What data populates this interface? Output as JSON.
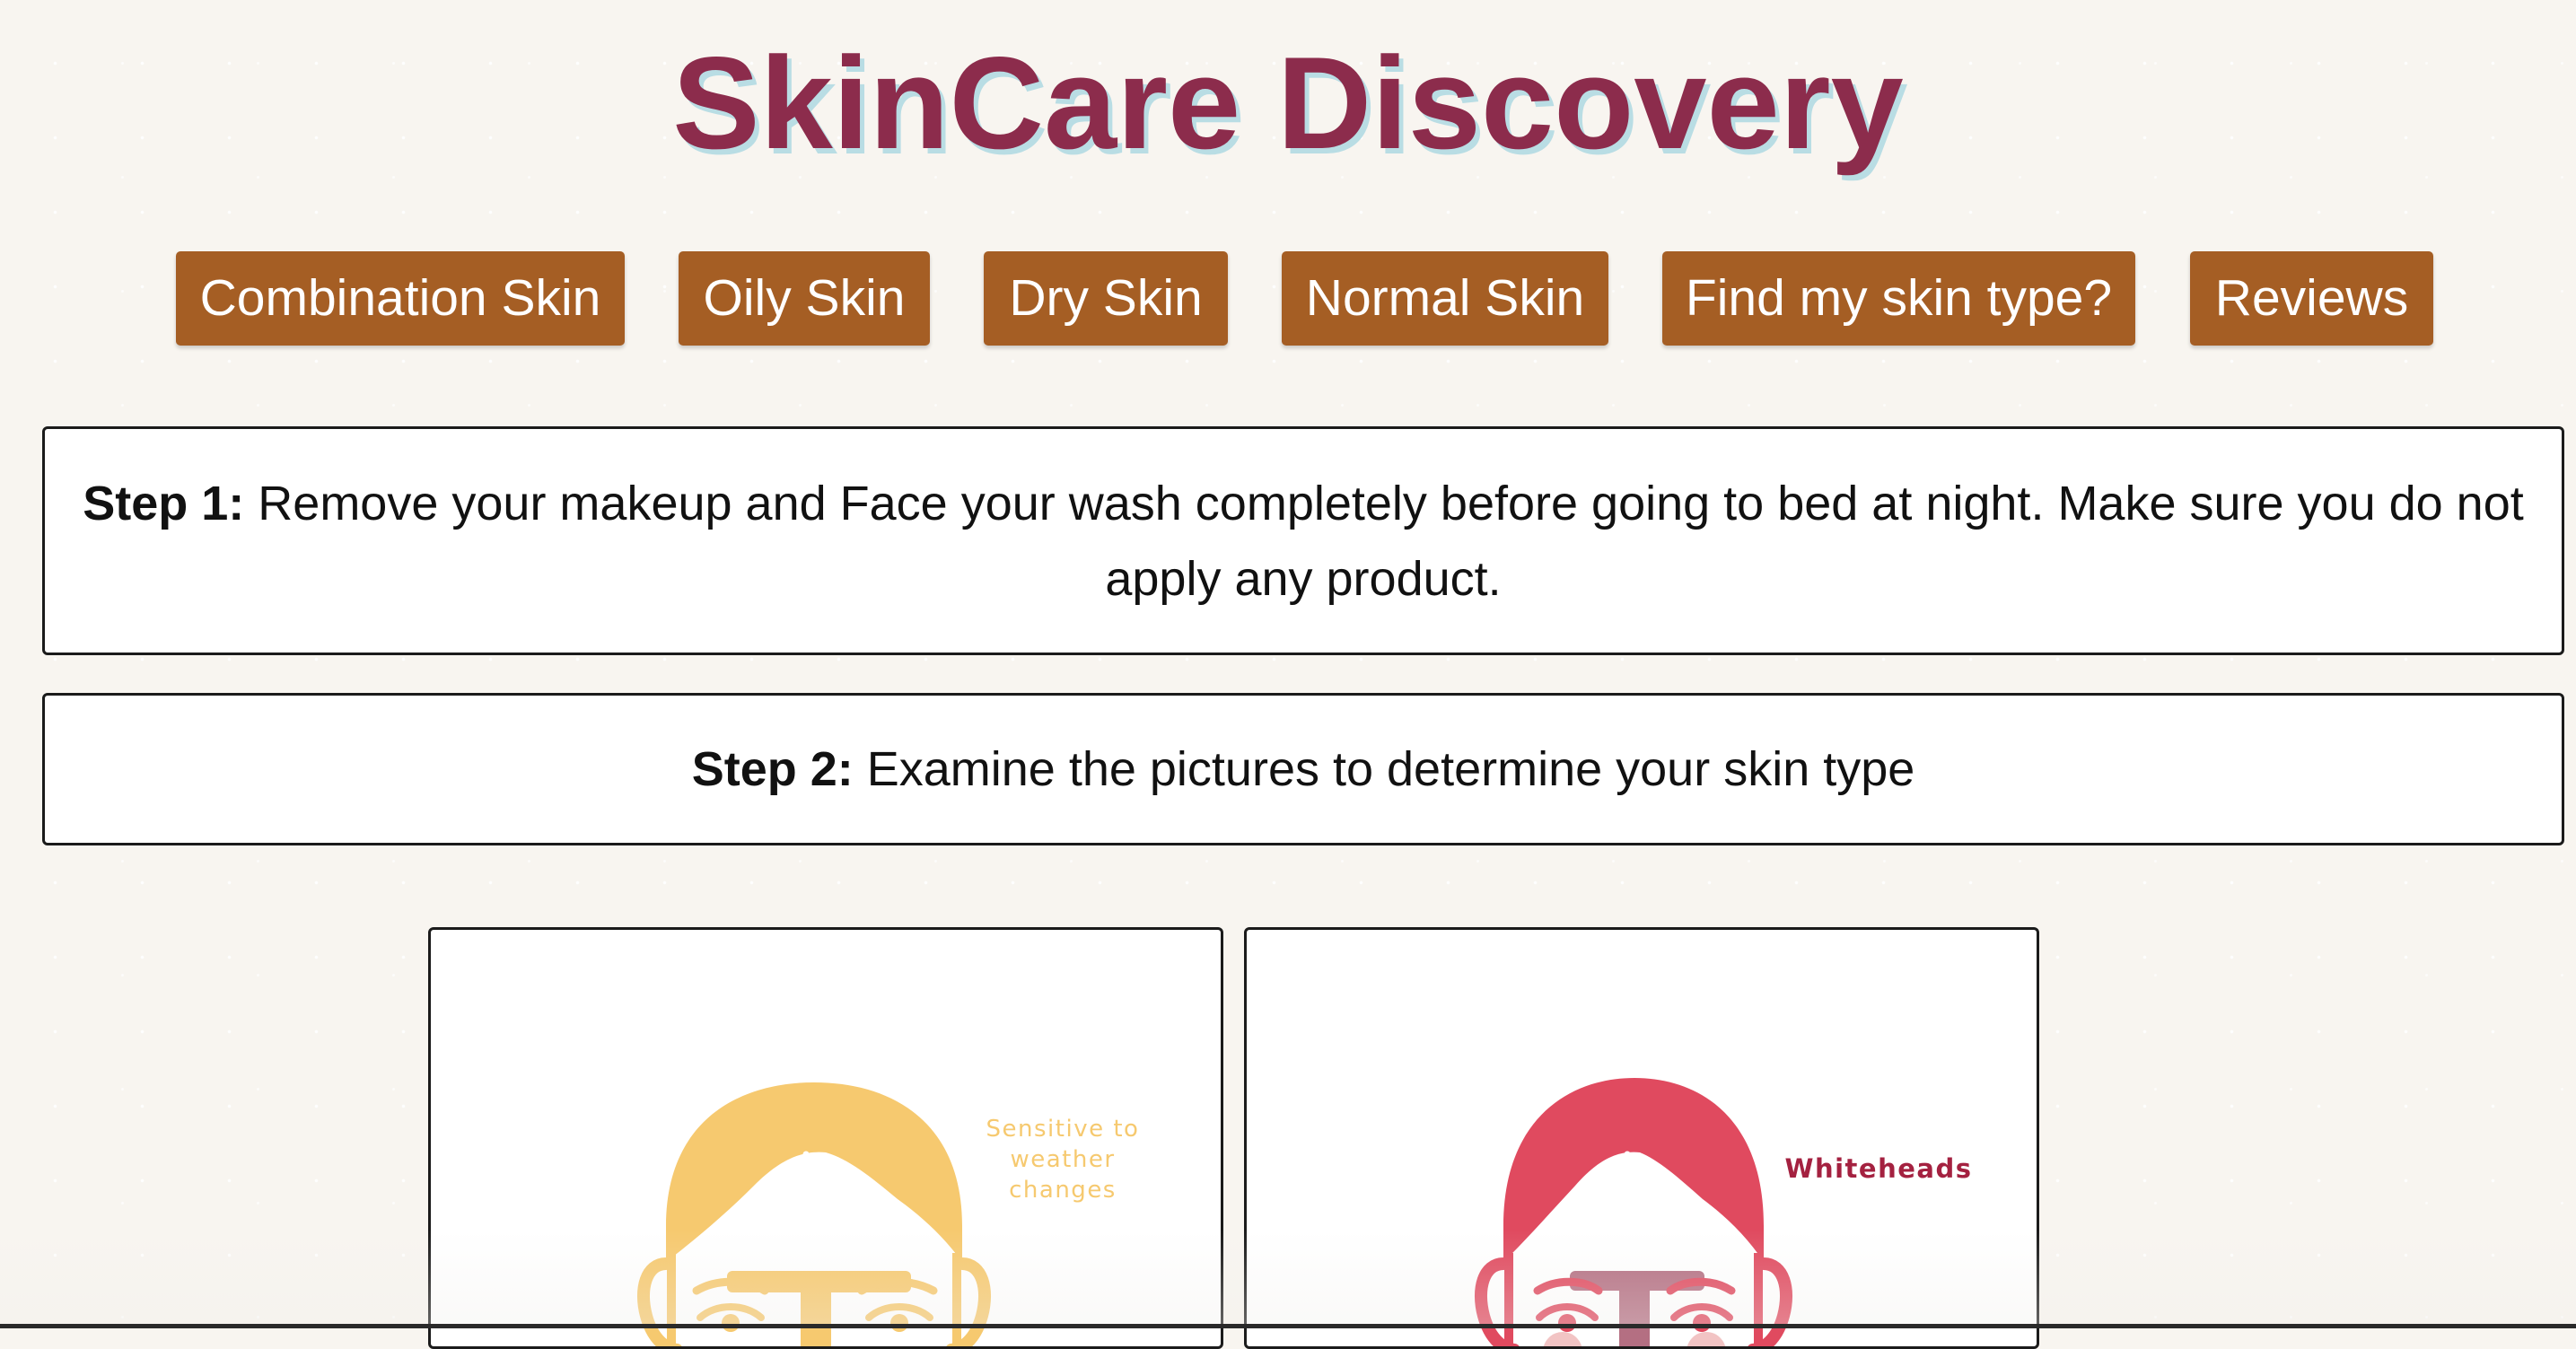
{
  "header": {
    "title": "SkinCare Discovery"
  },
  "nav": {
    "items": [
      {
        "label": "Combination Skin"
      },
      {
        "label": "Oily Skin"
      },
      {
        "label": "Dry Skin"
      },
      {
        "label": "Normal Skin"
      },
      {
        "label": "Find my skin type?"
      },
      {
        "label": "Reviews"
      }
    ]
  },
  "steps": [
    {
      "label": "Step 1:",
      "text": " Remove your makeup and Face your wash completely before going to bed at night. Make sure you do not apply any product."
    },
    {
      "label": "Step 2:",
      "text": " Examine the pictures to determine your skin type"
    }
  ],
  "cards": [
    {
      "caption_lines": [
        "Sensitive to",
        "weather",
        "changes"
      ],
      "color": "#f6c96f"
    },
    {
      "caption_lines": [
        "Whiteheads"
      ],
      "color": "#e04a5f",
      "caption_color": "#a42140"
    }
  ],
  "colors": {
    "background": "#f8f5f0",
    "title": "#8c2c4c",
    "title_shadow": "#b9dde4",
    "nav_button": "#a55e24",
    "nav_text": "#ffffff"
  }
}
